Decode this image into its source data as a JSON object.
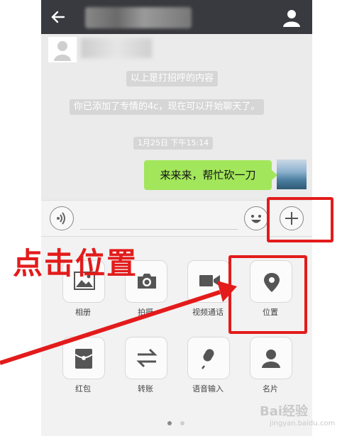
{
  "chat": {
    "system_messages": [
      "以上是打招呼的内容",
      "你已添加了专情的4c，现在可以开始聊天了。"
    ],
    "timestamp": "1月25日 下午15:14",
    "my_message": "来来来，帮忙砍一刀"
  },
  "panel": {
    "row1": [
      {
        "label": "相册",
        "icon": "photo-icon"
      },
      {
        "label": "拍摄",
        "icon": "camera-icon"
      },
      {
        "label": "视频通话",
        "icon": "video-icon"
      },
      {
        "label": "位置",
        "icon": "location-icon"
      }
    ],
    "row2": [
      {
        "label": "红包",
        "icon": "red-envelope-icon"
      },
      {
        "label": "转账",
        "icon": "transfer-icon"
      },
      {
        "label": "语音输入",
        "icon": "microphone-icon"
      },
      {
        "label": "名片",
        "icon": "contact-card-icon"
      }
    ]
  },
  "annotation": {
    "text": "点击位置",
    "color": "#e31b1b"
  },
  "watermark": {
    "text": "Bai经验",
    "subtext": "jingyan.baidu.com"
  },
  "colors": {
    "topbar": "#393a3f",
    "bubble": "#a2e65b",
    "annotation": "#e31b1b"
  }
}
